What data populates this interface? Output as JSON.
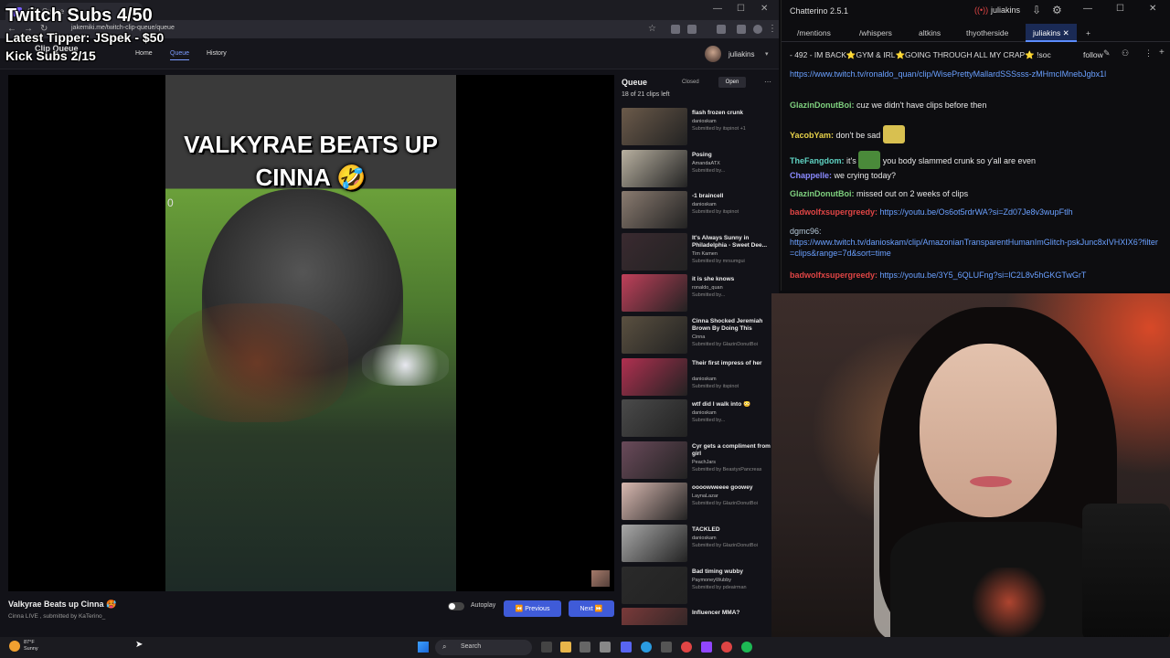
{
  "browser": {
    "tab_title": "Clip Queue",
    "url": "jakemiki.me/twitch-clip-queue/queue"
  },
  "app": {
    "brand": "Clip Queue",
    "nav": {
      "home": "Home",
      "queue": "Queue",
      "history": "History"
    },
    "user": "juliakins"
  },
  "player": {
    "overlay_title": "VALKYRAE BEATS UP CINNA 🤣",
    "overlay_zero": "0",
    "clip_title": "Valkyrae Beats up Cinna 🥵",
    "clip_meta": "Cinna LIVE , submitted by KaTerino_",
    "autoplay_label": "Autoplay",
    "previous_label": "Previous",
    "next_label": "Next"
  },
  "queue": {
    "title": "Queue",
    "closed_label": "Closed",
    "open_label": "Open",
    "count": "18 of 21 clips left",
    "items": [
      {
        "title": "flash frozen crunk",
        "channel": "danioskam",
        "submitted": "Submitted by itspinot +1",
        "color": "#6b5a4a"
      },
      {
        "title": "Posing",
        "channel": "AmandaATX",
        "submitted": "Submitted by...",
        "color": "#b8b0a0"
      },
      {
        "title": "-1 braincell",
        "channel": "danioskam",
        "submitted": "Submitted by itspinot",
        "color": "#8a7b70"
      },
      {
        "title": "It's Always Sunny in Philadelphia - Sweet Dee...",
        "channel": "Tim Kamen",
        "submitted": "Submitted by mrsumgui",
        "color": "#3a2a30"
      },
      {
        "title": "it is she knows",
        "channel": "ronaldo_quan",
        "submitted": "Submitted by...",
        "color": "#c0405a"
      },
      {
        "title": "Cinna Shocked Jeremiah Brown By Doing This",
        "channel": "Cinna",
        "submitted": "Submitted by GlazinDonutBoi",
        "color": "#5a5040"
      },
      {
        "title": "Their first impress of her",
        "channel": "danioskam",
        "submitted": "Submitted by itspinot",
        "color": "#b03050"
      },
      {
        "title": "wtf did I walk into 😳",
        "channel": "danioskam",
        "submitted": "Submitted by...",
        "color": "#4a4a4a"
      },
      {
        "title": "Cyr gets a compliment from a girl",
        "channel": "PeachJars",
        "submitted": "Submitted by BeastyxPancreas",
        "color": "#6a4a5a"
      },
      {
        "title": "oooowweeee goowey",
        "channel": "LaynaLazar",
        "submitted": "Submitted by GlazinDonutBoi",
        "color": "#d8b8b0"
      },
      {
        "title": "TACKLED",
        "channel": "danioskam",
        "submitted": "Submitted by GlazinDonutBoi",
        "color": "#a8a8a8"
      },
      {
        "title": "Bad timing wubby",
        "channel": "PaymoneyWubby",
        "submitted": "Submitted by pdeairman",
        "color": "#2a2a2a"
      },
      {
        "title": "Influencer MMA?",
        "channel": "",
        "submitted": "",
        "color": "#7a3a3a"
      }
    ]
  },
  "taskbar": {
    "weather_temp": "87°F",
    "weather_desc": "Sunny",
    "search_label": "Search"
  },
  "chatterino": {
    "title": "Chatterino 2.5.1",
    "user": "juliakins",
    "tabs": [
      "/mentions",
      "/whispers",
      "altkins",
      "thyotherside",
      "juliakins"
    ],
    "header": "- 492 - IM BACK⭐GYM & IRL⭐GOING THROUGH ALL MY CRAP⭐ !soc",
    "follow_label": "follow",
    "messages": [
      {
        "user": "",
        "color": "#e8e8e8",
        "text": "",
        "link": "https://www.twitch.tv/ronaldo_quan/clip/WisePrettyMallardSSSsss-zMHmcIMnebJgbx1l"
      },
      {
        "user": "GlazinDonutBoi:",
        "color": "#7fd17f",
        "text": "cuz we didn't have clips before then",
        "link": ""
      },
      {
        "user": "YacobYam:",
        "color": "#e8d24a",
        "text": "don't be sad",
        "link": ""
      },
      {
        "user": "TheFangdom:",
        "color": "#5fd3c3",
        "text": "it's",
        "text2": "you body slammed crunk so y'all are even",
        "link": ""
      },
      {
        "user": "Chappelle:",
        "color": "#8a8aff",
        "text": "we crying today?",
        "link": ""
      },
      {
        "user": "GlazinDonutBoi:",
        "color": "#7fd17f",
        "text": "missed out on 2 weeks of clips",
        "link": ""
      },
      {
        "user": "badwolfxsupergreedy:",
        "color": "#e04545",
        "text": "",
        "link": "https://youtu.be/Os6ot5rdrWA?si=Zd07Je8v3wupFtlh"
      },
      {
        "user": "dgmc96:",
        "color": "#b4c8d8",
        "text": "",
        "link": "https://www.twitch.tv/danioskam/clip/AmazonianTransparentHumanImGlitch-pskJunc8xIVHXIX6?filter=clips&range=7d&sort=time"
      },
      {
        "user": "badwolfxsupergreedy:",
        "color": "#e04545",
        "text": "",
        "link": "https://youtu.be/3Y5_6QLUFng?si=lC2L8v5hGKGTwGrT"
      }
    ]
  },
  "overlay": {
    "twitch_subs": "Twitch Subs 4/50",
    "latest_tipper": "Latest Tipper: JSpek - $50",
    "kick_subs": "Kick Subs 2/15"
  },
  "colors": {
    "accent_blue": "#3f5bd8",
    "chat_link": "#6aa0ff",
    "chat_active_tab": "#1a2a55"
  }
}
